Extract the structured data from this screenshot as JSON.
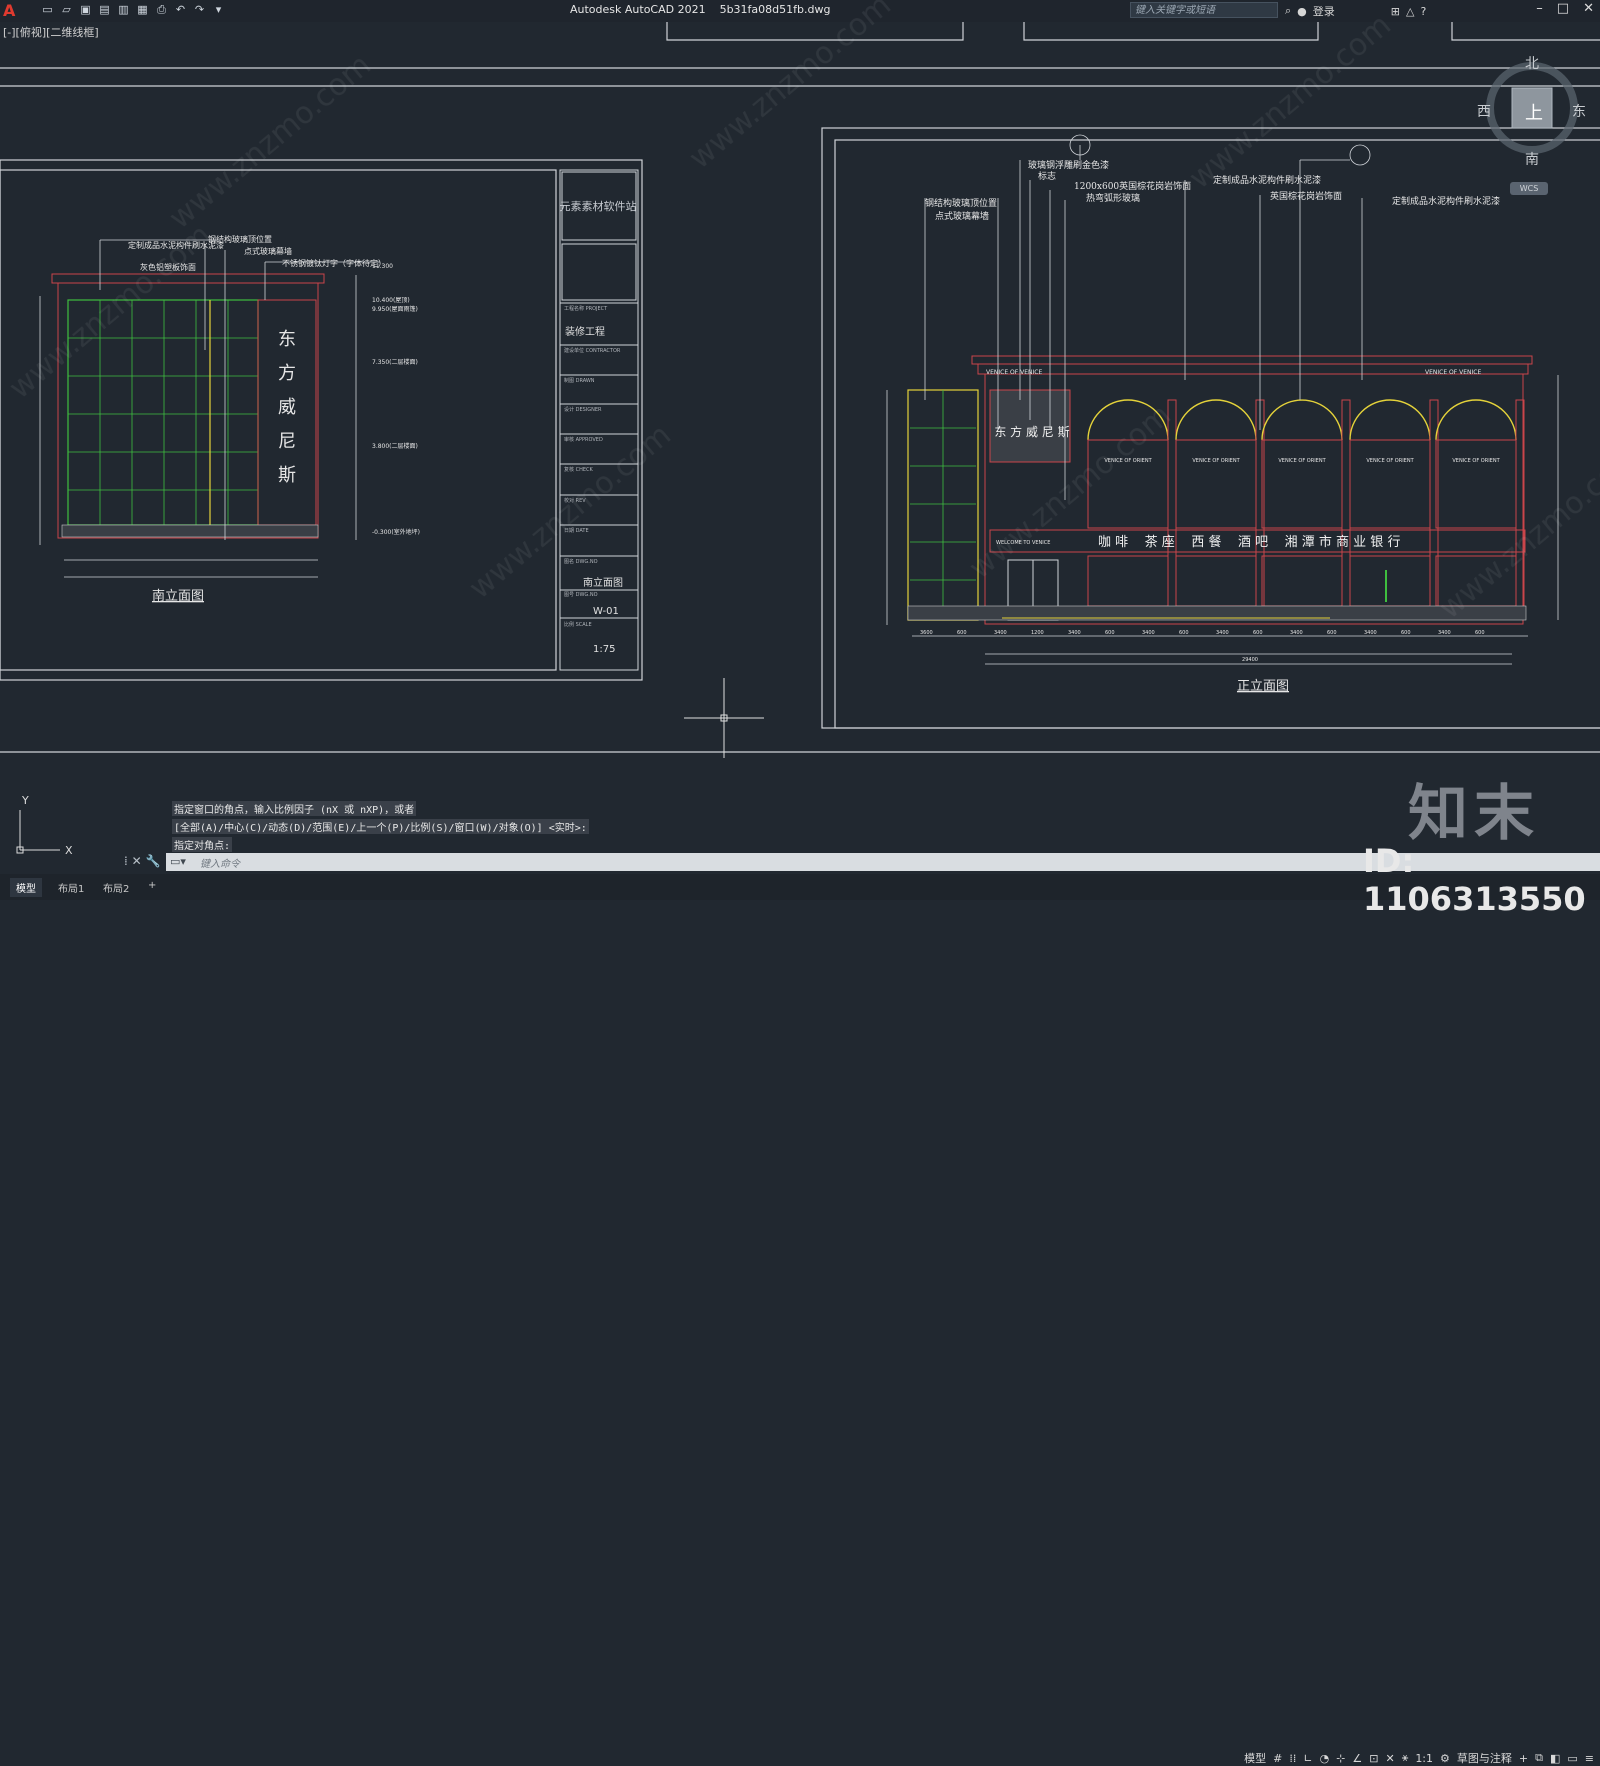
{
  "window": {
    "app_logo": "A",
    "title": "Autodesk AutoCAD 2021    5b31fa08d51fb.dwg",
    "search_placeholder": "键入关键字或短语",
    "login": "登录",
    "viewport_label": "[-][俯视][二维线框]"
  },
  "viewcube": {
    "north": "北",
    "south": "南",
    "east": "东",
    "west": "西",
    "face": "上",
    "wcs": "WCS"
  },
  "drawing": {
    "south_elevation": {
      "title": "南立面图",
      "signboard_chars": [
        "东",
        "方",
        "威",
        "尼",
        "斯"
      ],
      "annotations": [
        "定制成品水泥构件刷水泥漆",
        "钢结构玻璃顶位置",
        "点式玻璃幕墙",
        "灰色铝塑板饰面",
        "不锈钢镀钛灯字（字体待定）"
      ],
      "level_marks": [
        "11.300",
        "10.400(屋顶)",
        "9.950(屋面雨篷)",
        "7.350(二层楼面)",
        "3.800(二层楼面)",
        "-0.300(室外地坪)"
      ]
    },
    "title_block": {
      "company": "元素素材软件站",
      "project_label": "工程名称\nPROJECT",
      "project": "装修工程",
      "fields": [
        "建设单位\nCONTRACTOR",
        "制图\nDRAWN",
        "设计\nDESIGNER",
        "审核\nAPPROVED",
        "复核\nCHECK",
        "校对\nREV",
        "日期\nDATE"
      ],
      "drawing_name_label": "图名\nDWG.NO",
      "drawing_name": "南立面图",
      "drawing_no_label": "图号\nDWG.NO",
      "drawing_no": "W-01",
      "scale_label": "比例\nSCALE",
      "scale": "1:75"
    },
    "front_elevation": {
      "title": "正立面图",
      "signboard": "东 方 威 尼 斯",
      "banner": "咖 啡    茶 座    西 餐    酒 吧    湘 潭 市 商 业 银 行",
      "cornice_text_left": "VENICE OF VENICE",
      "cornice_text_right": "VENICE OF VENICE",
      "window_text": "VENICE OF ORIENT",
      "welcome": "WELCOME TO VENICE",
      "annotations": [
        "玻璃钢浮雕刷金色漆",
        "标志",
        "1200x600英国棕花岗岩饰面",
        "热弯弧形玻璃",
        "钢结构玻璃顶位置",
        "点式玻璃幕墙",
        "定制成品水泥构件刷水泥漆",
        "英国棕花岗岩饰面",
        "定制成品水泥构件刷水泥漆"
      ],
      "dimensions": [
        "3600",
        "600",
        "3400",
        "1200",
        "3400",
        "600",
        "3400",
        "600",
        "3400",
        "600",
        "3400",
        "600",
        "3400",
        "600",
        "3400",
        "600"
      ],
      "total_dim": "29400"
    }
  },
  "command": {
    "history": [
      "指定窗口的角点，输入比例因子 (nX 或 nXP)，或者",
      "[全部(A)/中心(C)/动态(D)/范围(E)/上一个(P)/比例(S)/窗口(W)/对象(O)] <实时>:",
      "指定对角点:"
    ],
    "placeholder": "键入命令"
  },
  "tabs": [
    "模型",
    "布局1",
    "布局2",
    "+"
  ],
  "status": {
    "model": "模型",
    "scale": "1:1",
    "workspace": "草图与注释"
  },
  "watermarks": {
    "site": "www.znzmo.com",
    "brand": "知末",
    "id": "ID: 1106313550"
  },
  "colors": {
    "background": "#212830",
    "frame": "#d8d8d8",
    "building_outline": "#c9454a",
    "glass_green": "#3fbf3f",
    "yellow": "#e4d23a"
  }
}
